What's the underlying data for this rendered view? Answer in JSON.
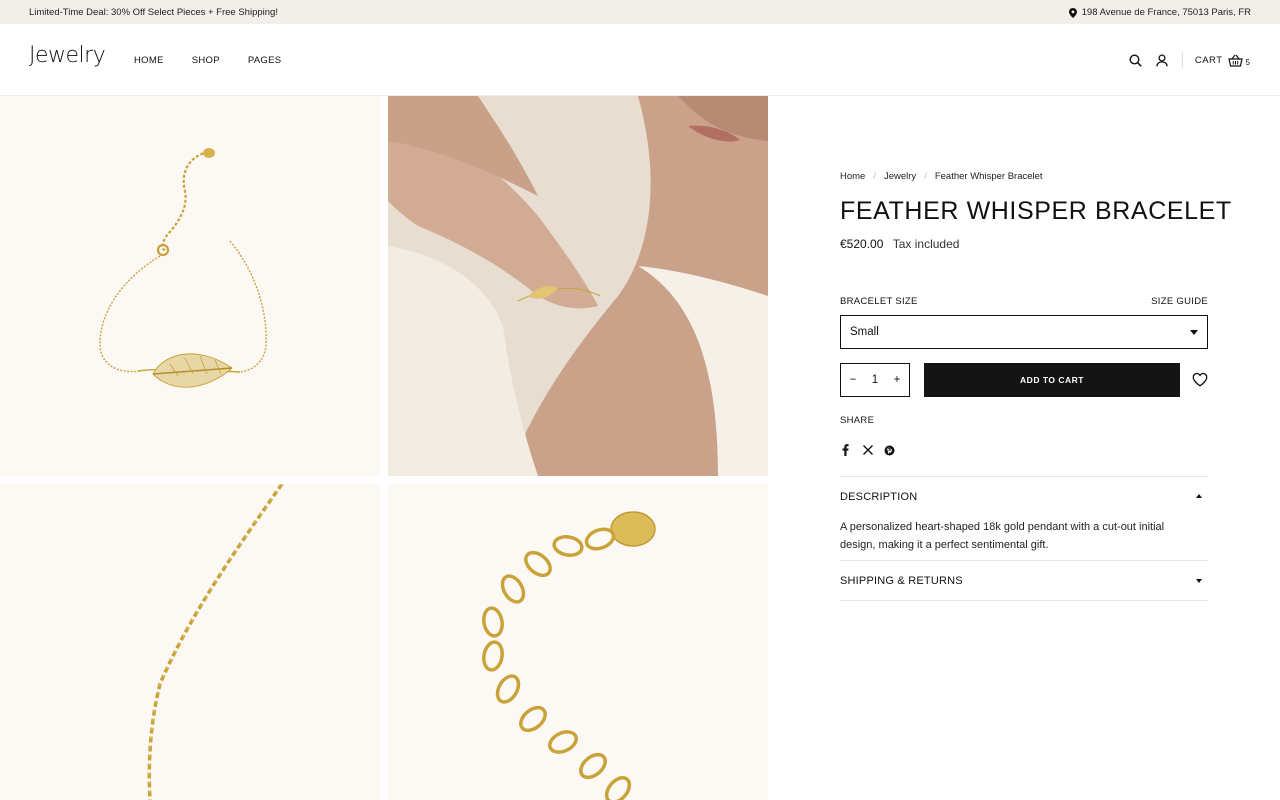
{
  "announcement": {
    "promo": "Limited-Time Deal: 30% Off Select Pieces + Free Shipping!",
    "address": "198 Avenue de France, 75013 Paris, FR"
  },
  "header": {
    "logo": "Jewelry",
    "nav": [
      "HOME",
      "SHOP",
      "PAGES"
    ],
    "cart_label": "CART",
    "cart_count": "5"
  },
  "breadcrumb": [
    "Home",
    "Jewelry",
    "Feather Whisper Bracelet"
  ],
  "product": {
    "title": "FEATHER WHISPER BRACELET",
    "price": "€520.00",
    "tax_note": "Tax included",
    "size_label": "BRACELET SIZE",
    "size_guide": "SIZE GUIDE",
    "size_selected": "Small",
    "quantity": "1",
    "qty_minus": "−",
    "qty_plus": "+",
    "add_to_cart": "ADD TO CART",
    "share_label": "SHARE"
  },
  "accordions": [
    {
      "title": "DESCRIPTION",
      "expanded": true,
      "body": "A personalized heart-shaped 18k gold pendant with a cut-out initial design, making it a perfect sentimental gift."
    },
    {
      "title": "SHIPPING & RETURNS",
      "expanded": false,
      "body": ""
    }
  ],
  "colors": {
    "topbar_bg": "#f2efea",
    "button_bg": "#141414",
    "gold": "#c9a33a",
    "tile_bg": "#fcf9f5"
  },
  "icons": [
    "location-pin-icon",
    "search-icon",
    "user-icon",
    "basket-icon",
    "heart-icon",
    "facebook-icon",
    "x-icon",
    "pinterest-icon"
  ]
}
